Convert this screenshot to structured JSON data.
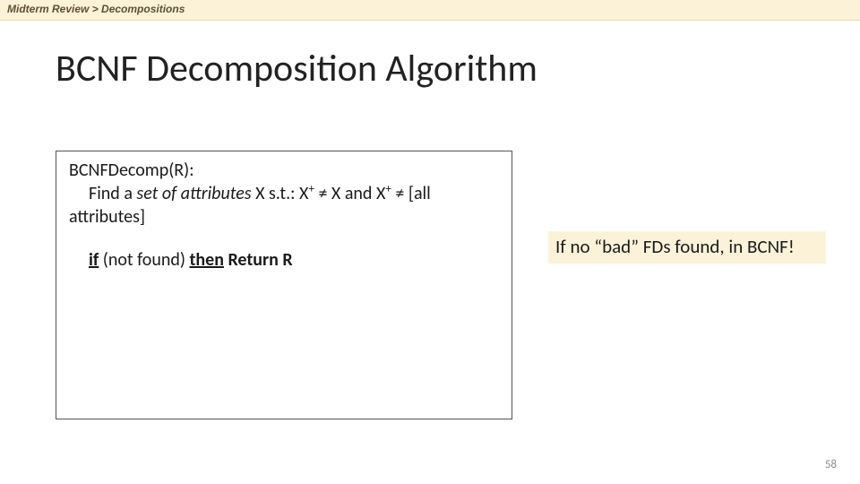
{
  "breadcrumb": "Midterm Review > Decompositions",
  "title": "BCNF Decomposition Algorithm",
  "algo": {
    "decomp_label": "BCNFDecomp(R):",
    "find_prefix": "Find a ",
    "find_ital": "set of attributes",
    "find_suffix_a": " X s.t.: X",
    "find_suffix_b": " ≠ X and X",
    "find_suffix_c": " ≠ [all attributes]",
    "sup": "+",
    "if_word": "if",
    "if_mid": " (not found) ",
    "then_word": "then",
    "return_phrase": " Return R"
  },
  "note_text": "If no “bad” FDs found, in BCNF!",
  "page_number": "58"
}
